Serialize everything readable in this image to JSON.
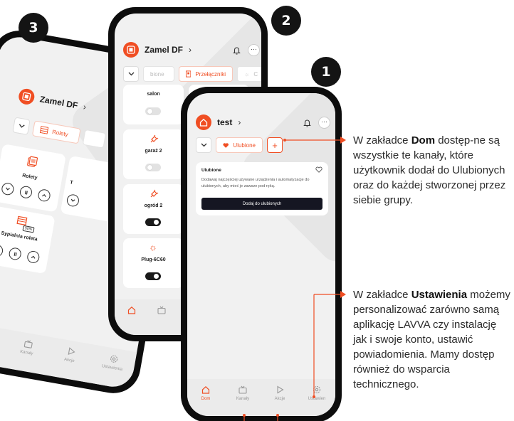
{
  "badges": [
    "1",
    "2",
    "3"
  ],
  "phone3": {
    "title": "Zamel DF",
    "tab_label": "Rolety",
    "cards": [
      {
        "name": "Rolety"
      },
      {
        "name": "Sypialnia roleta",
        "level_label": "50%"
      }
    ],
    "partial_letter": "T"
  },
  "phone2": {
    "title": "Zamel DF",
    "tabs": [
      "bione",
      "Przełączniki",
      "C"
    ],
    "cards": [
      {
        "name": "salon",
        "on": false
      },
      {
        "name": "garaż 2",
        "on": false
      },
      {
        "name": "ogród 2",
        "on": true
      },
      {
        "name": "Plug-6C60",
        "on": true
      }
    ]
  },
  "phone1": {
    "title": "test",
    "tab_label": "Ulubione",
    "fav_card": {
      "title": "Ulubione",
      "description": "Dodawaj najczęściej używane urządzenia i automatyzacje do ulubionych, aby mieć je zawsze pod ręką.",
      "button": "Dodaj do ulubionych"
    }
  },
  "nav": {
    "dom": "Dom",
    "kanaly": "Kanały",
    "akcje": "Akcje",
    "ustawienia": "Ustawienia",
    "ustawienia_cut": "Ustawien"
  },
  "callout_dom": {
    "p1": "W zakładce ",
    "bold": "Dom",
    "p2": " dostęp-ne są wszystkie te kanały, które użytkownik dodał do Ulubionych oraz do każdej stworzonej przez siebie grupy."
  },
  "callout_settings": {
    "p1": "W zakładce ",
    "bold": "Ustawienia",
    "p2": " możemy personalizować zarówno samą aplikację LAVVA czy instalację jak i swoje konto, ustawić powiadomienia. Mamy dostęp również do wsparcia technicznego."
  },
  "colors": {
    "accent": "#f04e23",
    "dark": "#141414",
    "screen_bg": "#f1f1f1"
  },
  "icons": [
    "house-icon",
    "bell-icon",
    "heart-icon",
    "plus-icon",
    "tv-icon",
    "play-icon",
    "gear-icon",
    "blinds-icon",
    "plug-icon",
    "bulb-icon"
  ]
}
